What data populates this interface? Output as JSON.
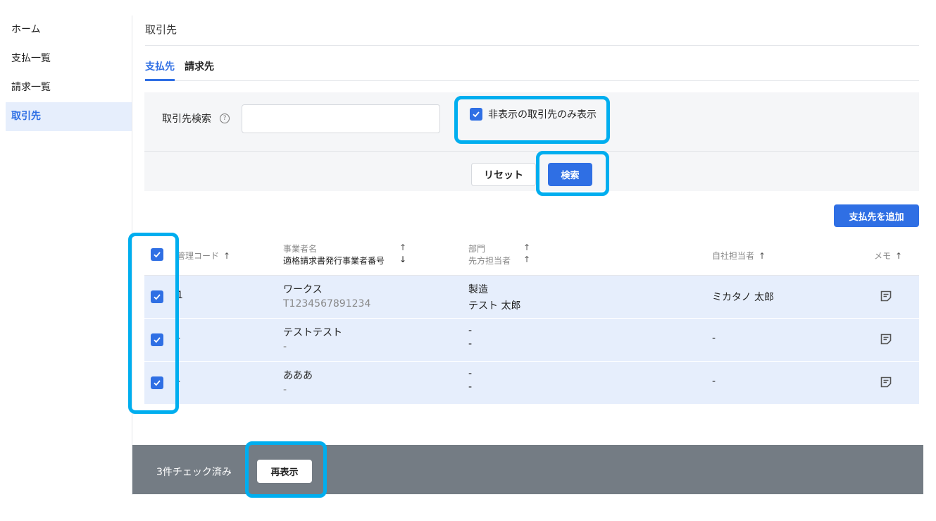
{
  "sidebar": {
    "items": [
      {
        "label": "ホーム"
      },
      {
        "label": "支払一覧"
      },
      {
        "label": "請求一覧"
      },
      {
        "label": "取引先"
      }
    ]
  },
  "header": {
    "title": "取引先"
  },
  "tabs": [
    {
      "label": "支払先"
    },
    {
      "label": "請求先"
    }
  ],
  "search": {
    "label": "取引先検索",
    "help_icon": "?",
    "value": "",
    "hidden_only_label": "非表示の取引先のみ表示",
    "reset_label": "リセット",
    "search_label": "検索"
  },
  "add_button_label": "支払先を追加",
  "table": {
    "headers": {
      "code": "管理コード",
      "name": "事業者名",
      "invoice_number": "適格請求書発行事業者番号",
      "department": "部門",
      "contact": "先方担当者",
      "owner": "自社担当者",
      "memo": "メモ"
    },
    "arrows": {
      "up": "↑",
      "down": "↓"
    },
    "rows": [
      {
        "code": "1",
        "name": "ワークス",
        "invoice_number": "T1234567891234",
        "department": "製造",
        "contact": "テスト 太郎",
        "owner": "ミカタノ 太郎"
      },
      {
        "code": "-",
        "name": "テストテスト",
        "invoice_number": "-",
        "department": "-",
        "contact": "-",
        "owner": "-"
      },
      {
        "code": "-",
        "name": "あああ",
        "invoice_number": "-",
        "department": "-",
        "contact": "-",
        "owner": "-"
      }
    ]
  },
  "footer": {
    "checked_count": "3件チェック済み",
    "redisplay_label": "再表示"
  },
  "colors": {
    "accent": "#2f6fe4",
    "selected_row": "#e6eefc",
    "footer_bg": "#747c84",
    "highlight": "#00aeef"
  }
}
